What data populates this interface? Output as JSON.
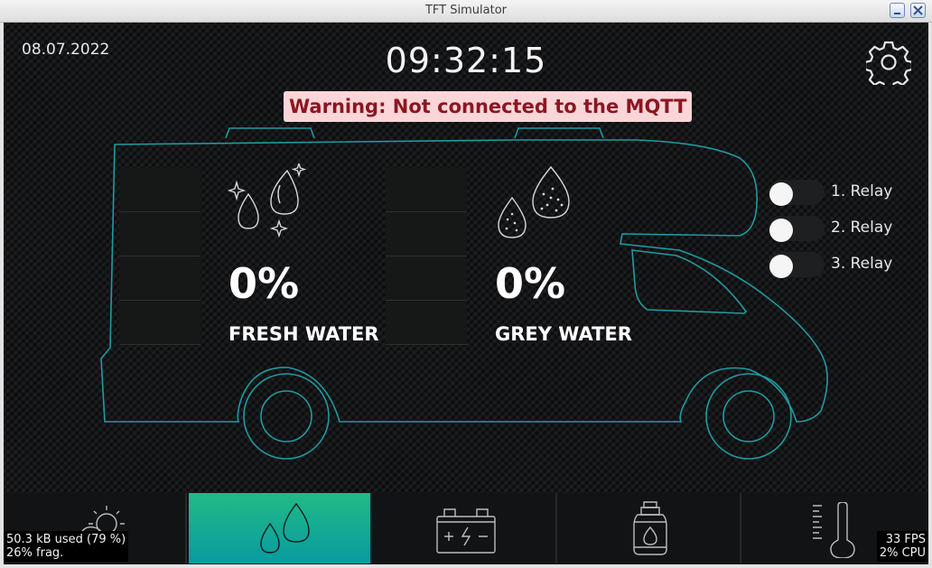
{
  "window": {
    "title": "TFT Simulator"
  },
  "header": {
    "date": "08.07.2022",
    "time": "09:32:15"
  },
  "warning": "Warning: Not connected to the MQTT",
  "tanks": {
    "fresh": {
      "percent_text": "0%",
      "label": "FRESH WATER",
      "level": 0
    },
    "grey": {
      "percent_text": "0%",
      "label": "GREY WATER",
      "level": 0
    }
  },
  "relays": [
    {
      "label": "1. Relay",
      "on": false
    },
    {
      "label": "2. Relay",
      "on": false
    },
    {
      "label": "3. Relay",
      "on": false
    }
  ],
  "nav": [
    {
      "name": "weather",
      "icon": "weather-icon",
      "active": false
    },
    {
      "name": "water",
      "icon": "water-drops-icon",
      "active": true
    },
    {
      "name": "battery",
      "icon": "battery-icon",
      "active": false
    },
    {
      "name": "gas",
      "icon": "gas-bottle-icon",
      "active": false
    },
    {
      "name": "temperature",
      "icon": "thermometer-icon",
      "active": false
    }
  ],
  "stats": {
    "mem_line1": "50.3 kB used (79 %)",
    "mem_line2": "26% frag.",
    "fps": "33 FPS",
    "cpu": "2% CPU"
  },
  "colors": {
    "accent": "#14a99a",
    "outline": "#1f9aa0",
    "warning_bg": "#fbd6d8",
    "warning_text": "#8c1622"
  }
}
